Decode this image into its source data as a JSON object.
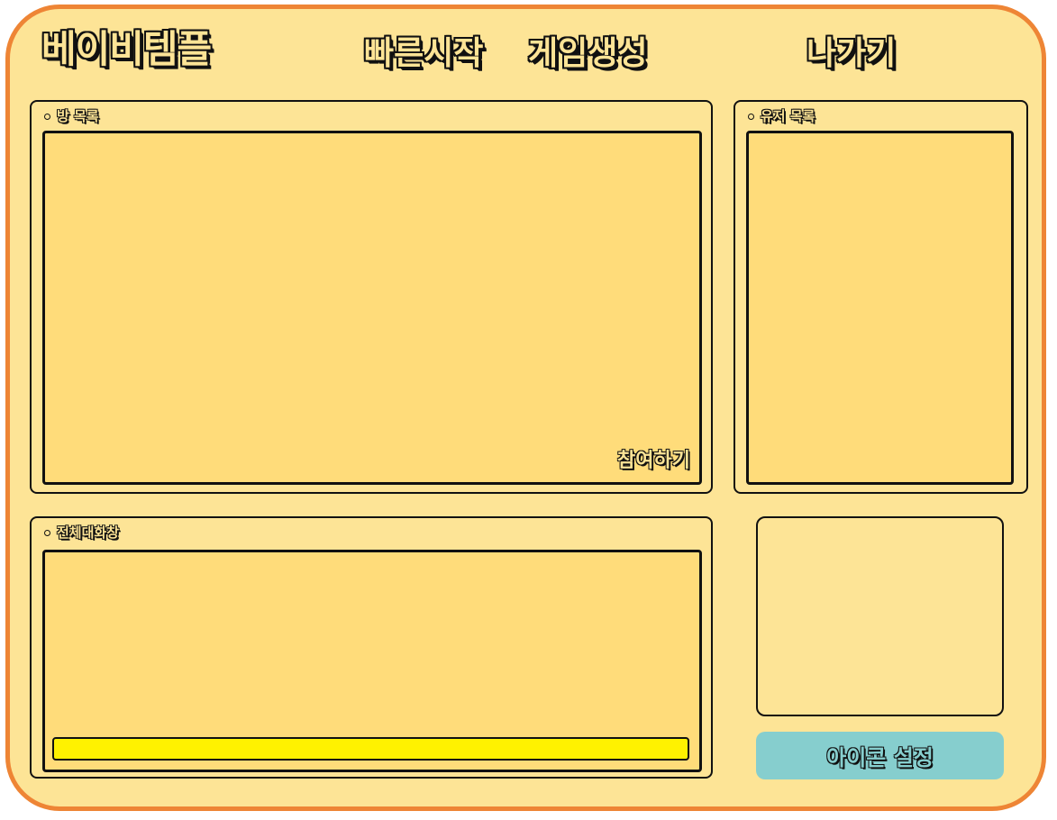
{
  "app": {
    "title": "베이비템플"
  },
  "nav": {
    "quick_start": "빠른시작",
    "create_game": "게임생성",
    "exit": "나가기"
  },
  "room_list": {
    "label": "방 목록",
    "join_label": "참여하기"
  },
  "user_list": {
    "label": "유저 목록"
  },
  "chat": {
    "label": "전체대화창"
  },
  "icon_settings": {
    "label": "아이콘 설정"
  },
  "colors": {
    "background": "#fde496",
    "border": "#ee8535",
    "panel_inner": "#ffdc7a",
    "chat_input": "#fff200",
    "icon_button": "#86cece"
  }
}
